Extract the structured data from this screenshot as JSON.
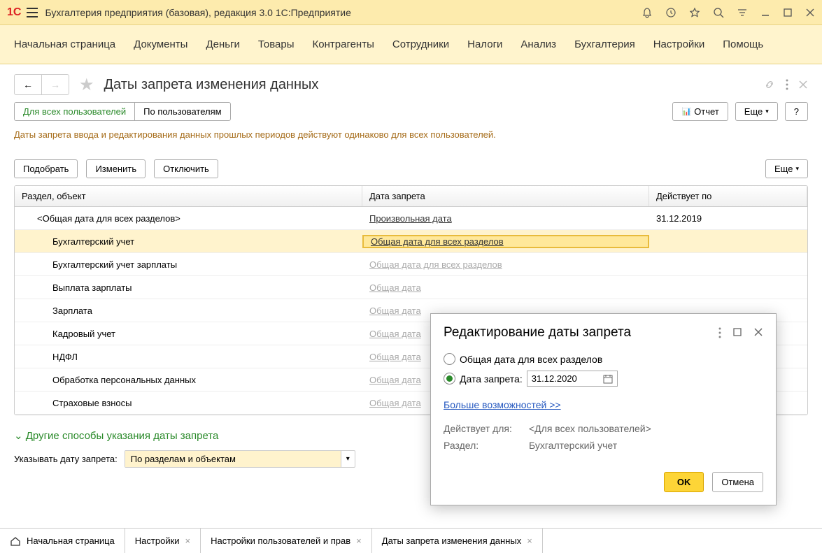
{
  "title": "Бухгалтерия предприятия (базовая), редакция 3.0 1С:Предприятие",
  "logo": "1C",
  "menu": [
    "Начальная страница",
    "Документы",
    "Деньги",
    "Товары",
    "Контрагенты",
    "Сотрудники",
    "Налоги",
    "Анализ",
    "Бухгалтерия",
    "Настройки",
    "Помощь"
  ],
  "page_title": "Даты запрета изменения данных",
  "segTabs": [
    "Для всех пользователей",
    "По пользователям"
  ],
  "btn_report": "Отчет",
  "btn_more": "Еще",
  "btn_help": "?",
  "hint": "Даты запрета ввода и редактирования данных прошлых периодов действуют одинаково для всех пользователей.",
  "btn_pick": "Подобрать",
  "btn_edit": "Изменить",
  "btn_off": "Отключить",
  "columns": [
    "Раздел, объект",
    "Дата запрета",
    "Действует по"
  ],
  "rows": [
    {
      "name": "<Общая дата для всех разделов>",
      "date": "Произвольная дата",
      "valid": "31.12.2019",
      "i": false,
      "d": false,
      "st": "u"
    },
    {
      "name": "Бухгалтерский учет",
      "date": "Общая дата для всех разделов",
      "valid": "",
      "i": true,
      "d": false,
      "st": "sel"
    },
    {
      "name": "Бухгалтерский учет зарплаты",
      "date": "Общая дата для всех разделов",
      "valid": "",
      "i": true,
      "d": false,
      "st": "g"
    },
    {
      "name": "Выплата зарплаты",
      "date": "Общая дата",
      "valid": "",
      "i": true,
      "d": false,
      "st": "g"
    },
    {
      "name": "Зарплата",
      "date": "Общая дата",
      "valid": "",
      "i": true,
      "d": false,
      "st": "g"
    },
    {
      "name": "Кадровый учет",
      "date": "Общая дата",
      "valid": "",
      "i": true,
      "d": false,
      "st": "g"
    },
    {
      "name": "НДФЛ",
      "date": "Общая дата",
      "valid": "",
      "i": true,
      "d": false,
      "st": "g"
    },
    {
      "name": "Обработка персональных данных",
      "date": "Общая дата",
      "valid": "",
      "i": true,
      "d": false,
      "st": "g"
    },
    {
      "name": "Страховые взносы",
      "date": "Общая дата",
      "valid": "",
      "i": true,
      "d": false,
      "st": "g"
    }
  ],
  "collapse": "Другие способы указания даты запрета",
  "config_label": "Указывать дату запрета:",
  "config_value": "По разделам и объектам",
  "bottom_tabs": [
    {
      "label": "Начальная страница",
      "close": false,
      "home": true
    },
    {
      "label": "Настройки",
      "close": true
    },
    {
      "label": "Настройки пользователей и прав",
      "close": true
    },
    {
      "label": "Даты запрета изменения данных",
      "close": true
    }
  ],
  "dialog": {
    "title": "Редактирование даты запрета",
    "opt1": "Общая дата для всех разделов",
    "opt2": "Дата запрета:",
    "date": "31.12.2020",
    "more": "Больше возможностей >>",
    "applies_label": "Действует для:",
    "applies_value": "<Для всех пользователей>",
    "section_label": "Раздел:",
    "section_value": "Бухгалтерский учет",
    "ok": "OK",
    "cancel": "Отмена"
  }
}
